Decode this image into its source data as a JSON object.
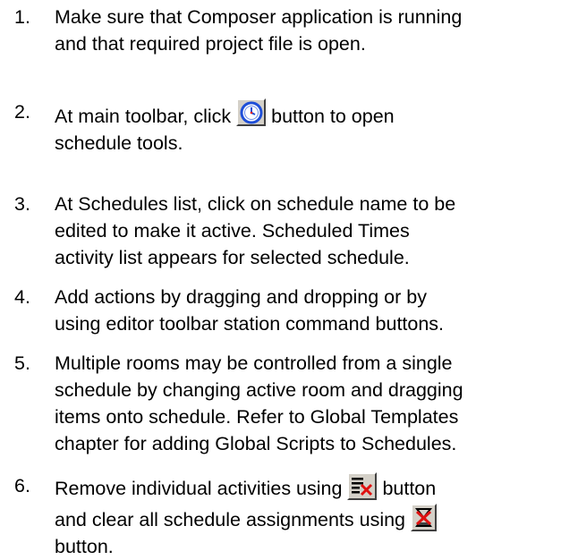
{
  "steps": [
    {
      "number": "1.",
      "lines": [
        "Make sure that Composer application is running",
        "and that required project file is open."
      ]
    },
    {
      "number": "2.",
      "line1_before": "At main toolbar, click",
      "line1_after": "button to open",
      "icon": "schedule-clock-icon",
      "line2": "schedule tools."
    },
    {
      "number": "3.",
      "lines": [
        "At Schedules list, click on schedule name to be",
        "edited to make it active. Scheduled Times",
        "activity list appears for selected schedule."
      ]
    },
    {
      "number": "4.",
      "lines": [
        "Add actions by dragging and dropping or by",
        "using editor toolbar station command buttons."
      ]
    },
    {
      "number": "5.",
      "lines": [
        "Multiple rooms may be controlled from a single",
        "schedule by changing active room and dragging",
        "items onto schedule. Refer to Global Templates",
        "chapter for adding Global Scripts to Schedules."
      ]
    },
    {
      "number": "6.",
      "line1_before": "Remove individual activities using",
      "line1_after": "button",
      "icon1": "remove-activity-icon",
      "line2_before": "and clear all schedule assignments using",
      "icon2": "clear-schedule-icon",
      "line3": "button."
    }
  ],
  "colors": {
    "text": "#000000",
    "background": "#ffffff",
    "icon_face": "#d4d0c8",
    "clock_blue": "#1f4fd8",
    "x_red": "#e01010"
  }
}
